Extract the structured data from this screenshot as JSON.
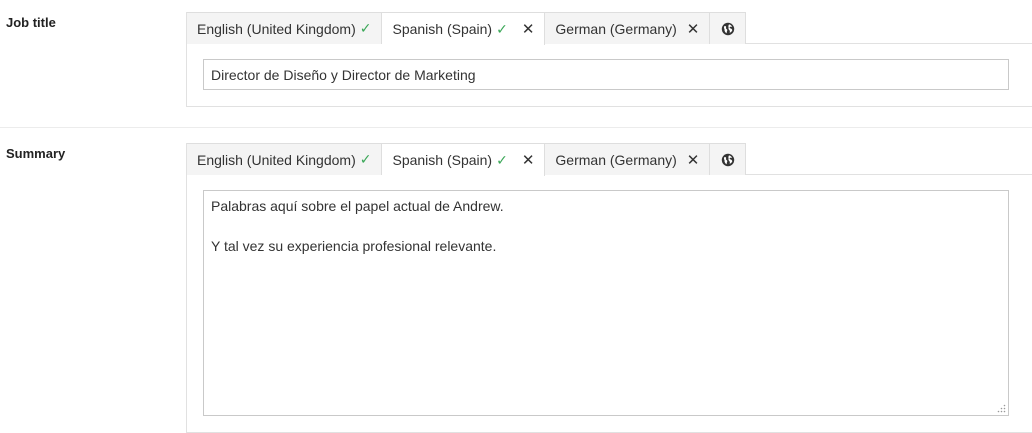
{
  "job_title": {
    "label": "Job title",
    "tabs": [
      {
        "label": "English (United Kingdom)",
        "check": "✓",
        "close": ""
      },
      {
        "label": "Spanish (Spain)",
        "check": "✓",
        "close": "✕"
      },
      {
        "label": "German (Germany)",
        "check": "",
        "close": "✕"
      }
    ],
    "value": "Director de Diseño y Director de Marketing"
  },
  "summary": {
    "label": "Summary",
    "tabs": [
      {
        "label": "English (United Kingdom)",
        "check": "✓",
        "close": ""
      },
      {
        "label": "Spanish (Spain)",
        "check": "✓",
        "close": "✕"
      },
      {
        "label": "German (Germany)",
        "check": "",
        "close": "✕"
      }
    ],
    "lines": [
      "Palabras aquí sobre el papel actual de Andrew.",
      "Y tal vez su experiencia profesional relevante."
    ]
  },
  "icons": {
    "checkmark": "check-icon",
    "close": "close-icon",
    "globe": "globe-icon"
  },
  "colors": {
    "check": "#3aa757",
    "tab_inactive_bg": "#f4f4f4",
    "border": "#c9c9c9"
  }
}
